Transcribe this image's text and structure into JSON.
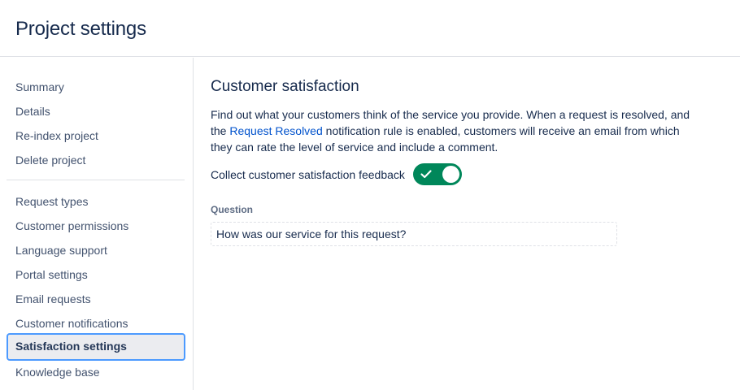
{
  "header": {
    "title": "Project settings"
  },
  "sidebar": {
    "groups": [
      {
        "items": [
          {
            "label": "Summary"
          },
          {
            "label": "Details"
          },
          {
            "label": "Re-index project"
          },
          {
            "label": "Delete project"
          }
        ]
      },
      {
        "items": [
          {
            "label": "Request types"
          },
          {
            "label": "Customer permissions"
          },
          {
            "label": "Language support"
          },
          {
            "label": "Portal settings"
          },
          {
            "label": "Email requests"
          },
          {
            "label": "Customer notifications"
          },
          {
            "label": "Satisfaction settings",
            "selected": true
          },
          {
            "label": "Knowledge base"
          }
        ]
      }
    ]
  },
  "main": {
    "section_title": "Customer satisfaction",
    "description": {
      "before_link": "Find out what your customers think of the service you provide. When a request is resolved, and the ",
      "link_text": "Request Resolved",
      "after_link": " notification rule is enabled, customers will receive an email from which they can rate the level of service and include a comment."
    },
    "toggle": {
      "label": "Collect customer satisfaction feedback",
      "state": "on",
      "color": "#00875a"
    },
    "question": {
      "label": "Question",
      "value": "How was our service for this request?"
    }
  },
  "colors": {
    "link": "#0052cc",
    "selected_border": "#4c9aff",
    "selected_bg": "#ebecf0"
  }
}
